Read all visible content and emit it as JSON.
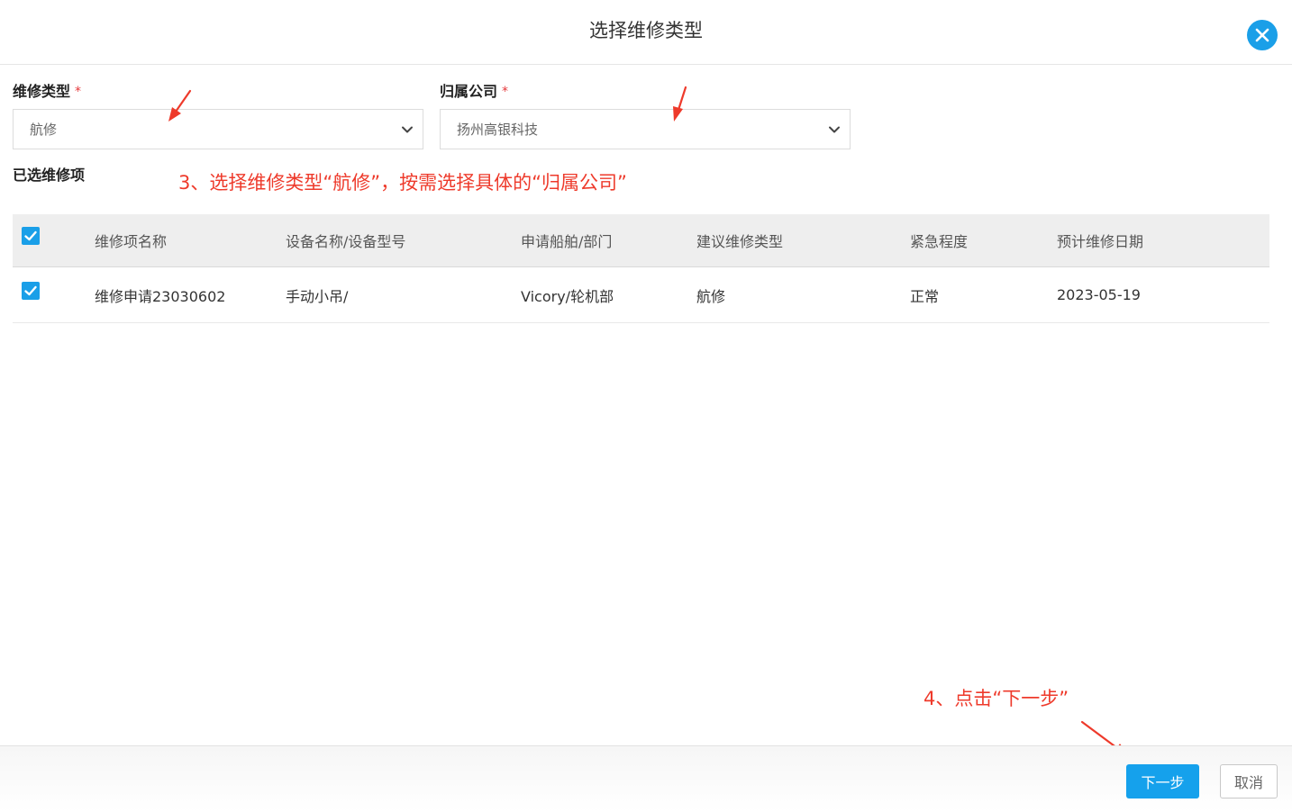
{
  "dialog": {
    "title": "选择维修类型"
  },
  "form": {
    "repair_type": {
      "label": "维修类型",
      "required_mark": "*",
      "value": "航修"
    },
    "company": {
      "label": "归属公司",
      "required_mark": "*",
      "value": "扬州高银科技"
    }
  },
  "selected_section": {
    "label": "已选维修项"
  },
  "annotations": {
    "step3": "3、选择维修类型“航修”，按需选择具体的“归属公司”",
    "step4": "4、点击“下一步”"
  },
  "table": {
    "header_checked": true,
    "columns": [
      "维修项名称",
      "设备名称/设备型号",
      "申请船舶/部门",
      "建议维修类型",
      "紧急程度",
      "预计维修日期"
    ],
    "rows": [
      {
        "checked": true,
        "cells": [
          "维修申请23030602",
          "手动小吊/",
          "Vicory/轮机部",
          "航修",
          "正常",
          "2023-05-19"
        ]
      }
    ]
  },
  "footer": {
    "next_label": "下一步",
    "cancel_label": "取消"
  },
  "colors": {
    "accent": "#15a1ec",
    "annotation": "#ee3a2b",
    "required": "#e5393c"
  },
  "icons": {
    "close": "close-icon",
    "dropdown": "chevron-down-icon",
    "checkbox": "check-icon"
  }
}
